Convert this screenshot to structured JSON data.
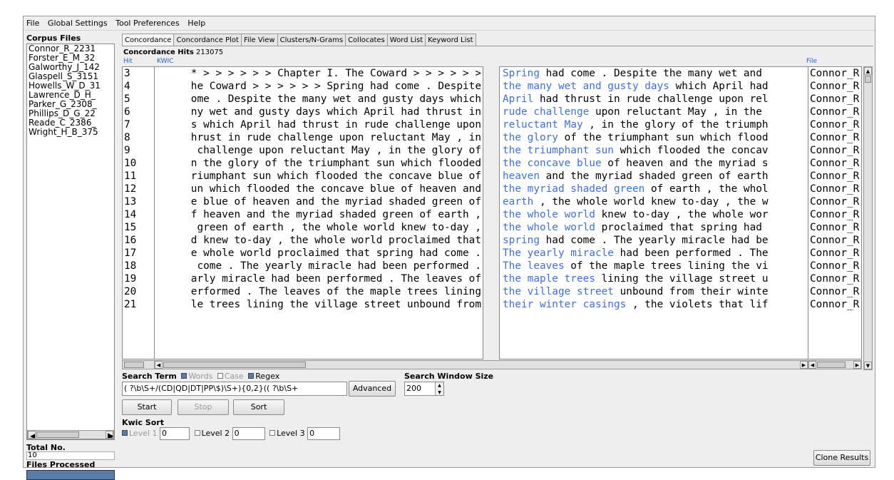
{
  "menu": [
    "File",
    "Global Settings",
    "Tool Preferences",
    "Help"
  ],
  "left": {
    "corpus_label": "Corpus Files",
    "files": [
      "Connor_R_2231",
      "Forster_E_M_32",
      "Galworthy_J_142",
      "Glaspell_S_3151",
      "Howells_W_D_31",
      "Lawrence_D_H_",
      "Parker_G_2308_",
      "Phillips_D_G_22",
      "Reade_C_2386_",
      "Wright_H_B_375"
    ],
    "total_label": "Total No.",
    "total_value": "10",
    "files_processed_label": "Files Processed"
  },
  "tabs": [
    "Concordance",
    "Concordance Plot",
    "File View",
    "Clusters/N-Grams",
    "Collocates",
    "Word List",
    "Keyword List"
  ],
  "concordance": {
    "hits_label": "Concordance Hits",
    "hits_value": "213075",
    "col_hit": "Hit",
    "col_kwic": "KWIC",
    "col_file": "File",
    "rows": [
      {
        "hit": "3",
        "left": "* > > > > > > Chapter I. The Coward > > > > > >",
        "kw": "Spring",
        "right": " had come . Despite the many wet and",
        "file": "Connor_R"
      },
      {
        "hit": "4",
        "left": "he Coward > > > > > > Spring had come . Despite",
        "kw": "the many wet and gusty days",
        "right": " which April had",
        "file": "Connor_R"
      },
      {
        "hit": "5",
        "left": "ome . Despite the many wet and gusty days which",
        "kw": "April",
        "right": " had thrust in rude challenge upon rel",
        "file": "Connor_R"
      },
      {
        "hit": "6",
        "left": "ny wet and gusty days which April had thrust in",
        "kw": "rude challenge",
        "right": " upon reluctant May , in the",
        "file": "Connor_R"
      },
      {
        "hit": "7",
        "left": "s which April had thrust in rude challenge upon",
        "kw": "reluctant May",
        "right": " , in the glory of the triumph",
        "file": "Connor_R"
      },
      {
        "hit": "8",
        "left": "hrust in rude challenge upon reluctant May , in",
        "kw": "the glory",
        "right": " of the triumphant sun which flood",
        "file": "Connor_R"
      },
      {
        "hit": "9",
        "left": "challenge upon reluctant May , in the glory of",
        "kw": "the triumphant sun",
        "right": " which flooded the concav",
        "file": "Connor_R"
      },
      {
        "hit": "10",
        "left": "n the glory of the triumphant sun which flooded",
        "kw": "the concave blue",
        "right": " of heaven and the myriad s",
        "file": "Connor_R"
      },
      {
        "hit": "11",
        "left": "riumphant sun which flooded the concave blue of",
        "kw": "heaven",
        "right": " and the myriad shaded green of earth",
        "file": "Connor_R"
      },
      {
        "hit": "12",
        "left": "un which flooded the concave blue of heaven and",
        "kw": "the myriad shaded green",
        "right": " of earth , the whol",
        "file": "Connor_R"
      },
      {
        "hit": "13",
        "left": "e blue of heaven and the myriad shaded green of",
        "kw": "earth",
        "right": " , the whole world knew to-day , the w",
        "file": "Connor_R"
      },
      {
        "hit": "14",
        "left": "f heaven and the myriad shaded green of earth ,",
        "kw": "the whole world",
        "right": " knew to-day , the whole wor",
        "file": "Connor_R"
      },
      {
        "hit": "15",
        "left": "green of earth , the whole world knew to-day ,",
        "kw": "the whole world",
        "right": " proclaimed that spring had",
        "file": "Connor_R"
      },
      {
        "hit": "16",
        "left": "d knew to-day , the whole world proclaimed that",
        "kw": "spring",
        "right": " had come . The yearly miracle had be",
        "file": "Connor_R"
      },
      {
        "hit": "17",
        "left": "e whole world proclaimed that spring had come .",
        "kw": "The yearly miracle",
        "right": " had been performed . The",
        "file": "Connor_R"
      },
      {
        "hit": "18",
        "left": "come . The yearly miracle had been performed .",
        "kw": "The leaves",
        "right": " of the maple trees lining the vi",
        "file": "Connor_R"
      },
      {
        "hit": "19",
        "left": "arly miracle had been performed . The leaves of",
        "kw": "the maple trees",
        "right": " lining the village street u",
        "file": "Connor_R"
      },
      {
        "hit": "20",
        "left": "erformed . The leaves of the maple trees lining",
        "kw": "the village street",
        "right": " unbound from their winte",
        "file": "Connor_R"
      },
      {
        "hit": "21",
        "left": "le trees lining the village street unbound from",
        "kw": "their winter casings",
        "right": " , the violets that lif",
        "file": "Connor_R"
      }
    ]
  },
  "search": {
    "term_label": "Search Term",
    "words_label": "Words",
    "case_label": "Case",
    "regex_label": "Regex",
    "term_value": "( ?\\b\\S+/(CD|QD|DT|PP\\$)\\S+){0,2}(( ?\\b\\S+",
    "advanced_label": "Advanced",
    "window_label": "Search Window Size",
    "window_value": "200",
    "start_label": "Start",
    "stop_label": "Stop",
    "sort_label": "Sort"
  },
  "kwic_sort": {
    "label": "Kwic Sort",
    "level1_label": "Level 1",
    "level1_value": "0",
    "level2_label": "Level 2",
    "level2_value": "0",
    "level3_label": "Level 3",
    "level3_value": "0"
  },
  "clone_label": "Clone Results",
  "colors": {
    "keyword": "#3d6fdd",
    "progress": "#5b7ba8"
  }
}
